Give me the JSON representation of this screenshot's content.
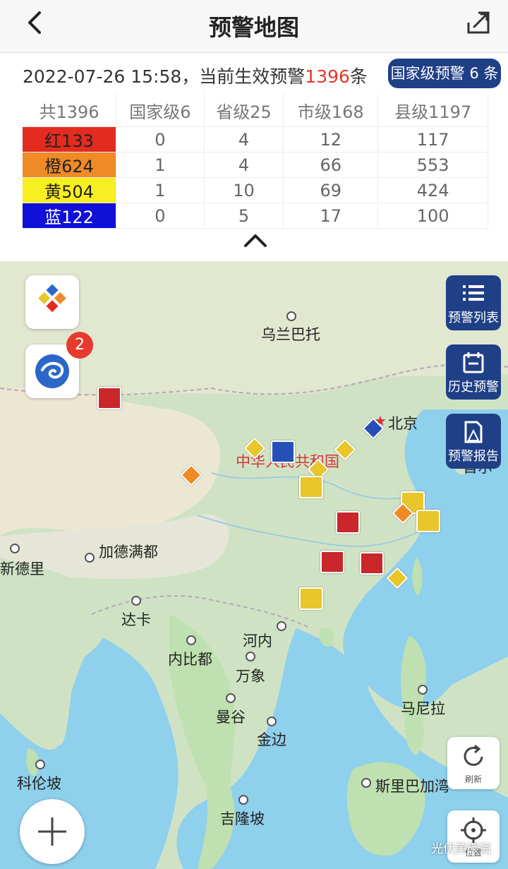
{
  "header": {
    "title": "预警地图",
    "back_icon": "chevron-left-icon",
    "share_icon": "share-icon"
  },
  "summary": {
    "prefix": "2022-07-26 15:58，当前生效预警",
    "count": "1396",
    "suffix": "条",
    "badge": "国家级预警 6 条"
  },
  "table": {
    "headers": [
      "共1396",
      "国家级6",
      "省级25",
      "市级168",
      "县级1197"
    ],
    "rows": [
      {
        "label": "红133",
        "values": [
          "0",
          "4",
          "12",
          "117"
        ],
        "color": "#e42b20"
      },
      {
        "label": "橙624",
        "values": [
          "1",
          "4",
          "66",
          "553"
        ],
        "color": "#f08a24"
      },
      {
        "label": "黄504",
        "values": [
          "1",
          "10",
          "69",
          "424"
        ],
        "color": "#f7ef21"
      },
      {
        "label": "蓝122",
        "values": [
          "0",
          "5",
          "17",
          "100"
        ],
        "color": "#1010d8"
      }
    ]
  },
  "map": {
    "country_label": "中华人民共和国",
    "cities": [
      "乌兰巴托",
      "北京",
      "加德满都",
      "新德里",
      "达卡",
      "河内",
      "内比都",
      "万象",
      "曼谷",
      "马尼拉",
      "金边",
      "科伦坡",
      "斯里巴加湾",
      "吉隆坡",
      "首尔"
    ],
    "badge_count": "2",
    "side_buttons": [
      "预警列表",
      "历史预警",
      "预警报告"
    ],
    "refresh_label": "刷新",
    "locate_label": "位置",
    "watermark": "光伏美碳翁"
  }
}
